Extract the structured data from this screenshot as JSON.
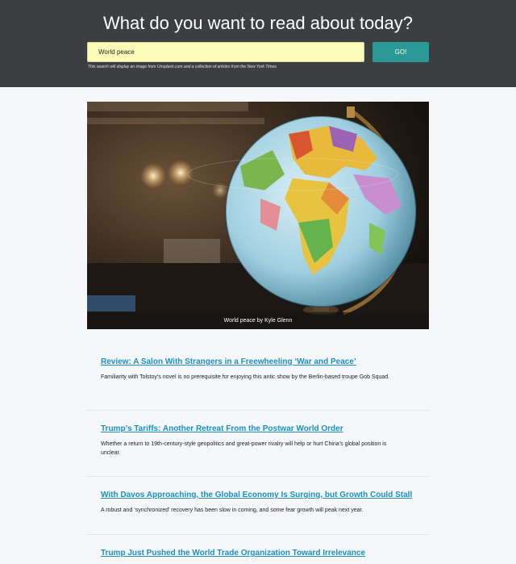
{
  "header": {
    "title": "What do you want to read about today?",
    "search_value": "World peace",
    "go_label": "GO!",
    "hint": "This search will display an image from Unsplash.com and a collection of articles from the New York Times"
  },
  "hero": {
    "caption": "World peace by Kyle Glenn"
  },
  "articles": [
    {
      "title": "Review: A Salon With Strangers in a Freewheeling ‘War and Peace’",
      "summary": "Familiarity with Tolstoy’s novel is no prerequisite for enjoying this antic show by the Berlin-based troupe Gob Squad."
    },
    {
      "title": "Trump’s Tariffs: Another Retreat From the Postwar World Order",
      "summary": "Whether a return to 19th-century-style geopolitics and great-power rivalry will help or hurt China’s global position is unclear."
    },
    {
      "title": "With Davos Approaching, the Global Economy Is Surging, but Growth Could Stall",
      "summary": "A robust and ‘synchronized’ recovery has been slow in coming, and some fear growth will peak next year."
    },
    {
      "title": "Trump Just Pushed the World Trade Organization Toward Irrelevance",
      "summary": ""
    }
  ],
  "colors": {
    "header_bg": "#3b3f42",
    "search_bg": "#fdfdb9",
    "go_bg": "#2b9a96",
    "link": "#1b8fbf",
    "page_bg": "#f6f7fa"
  }
}
